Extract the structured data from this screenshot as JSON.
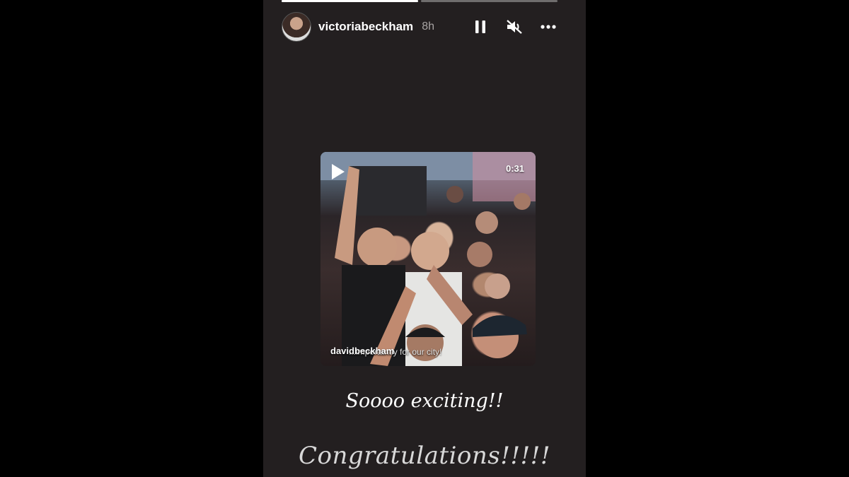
{
  "story": {
    "progress": [
      1.0,
      0.0
    ],
    "username": "victoriabeckham",
    "time_ago": "8h",
    "icons": [
      "pause-icon",
      "mute-icon",
      "more-icon"
    ]
  },
  "post": {
    "duration": "0:31",
    "username": "davidbeckham",
    "caption": "...importantly for our city!"
  },
  "texts": {
    "line1": "Soooo exciting!!",
    "line2": "Congratulations!!!!!"
  }
}
